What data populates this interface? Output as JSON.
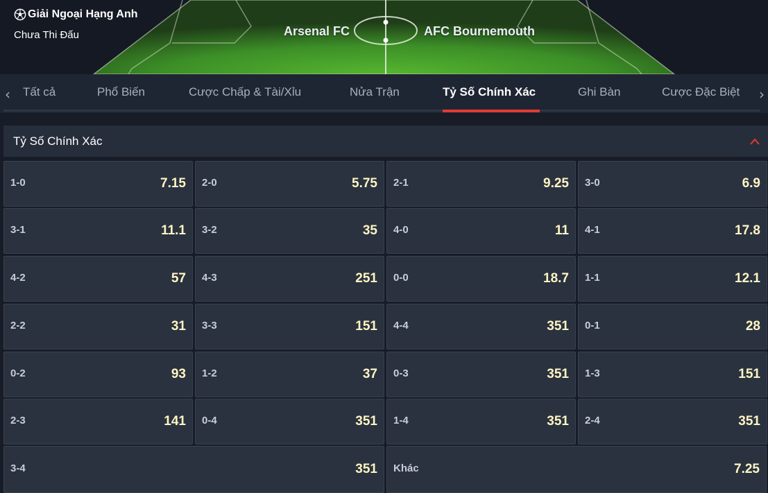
{
  "header": {
    "league": "Giải Ngoại Hạng Anh",
    "status": "Chưa Thi Đấu",
    "home_team": "Arsenal FC",
    "away_team": "AFC Bournemouth",
    "league_icon": "soccer-ball-icon"
  },
  "tabs": [
    {
      "label": "Tất cả",
      "active": false
    },
    {
      "label": "Phổ Biến",
      "active": false
    },
    {
      "label": "Cược Chấp & Tài/Xỉu",
      "active": false
    },
    {
      "label": "Nửa Trận",
      "active": false
    },
    {
      "label": "Tỷ Số Chính Xác",
      "active": true
    },
    {
      "label": "Ghi Bàn",
      "active": false
    },
    {
      "label": "Cược Đặc Biệt",
      "active": false
    }
  ],
  "tab_nav": {
    "prev_icon": "chevron-left-icon",
    "next_icon": "chevron-right-icon"
  },
  "section": {
    "title": "Tỷ Số Chính Xác",
    "collapse_icon": "chevron-up-icon"
  },
  "odds": [
    {
      "score": "1-0",
      "price": "7.15"
    },
    {
      "score": "2-0",
      "price": "5.75"
    },
    {
      "score": "2-1",
      "price": "9.25"
    },
    {
      "score": "3-0",
      "price": "6.9"
    },
    {
      "score": "3-1",
      "price": "11.1"
    },
    {
      "score": "3-2",
      "price": "35"
    },
    {
      "score": "4-0",
      "price": "11"
    },
    {
      "score": "4-1",
      "price": "17.8"
    },
    {
      "score": "4-2",
      "price": "57"
    },
    {
      "score": "4-3",
      "price": "251"
    },
    {
      "score": "0-0",
      "price": "18.7"
    },
    {
      "score": "1-1",
      "price": "12.1"
    },
    {
      "score": "2-2",
      "price": "31"
    },
    {
      "score": "3-3",
      "price": "151"
    },
    {
      "score": "4-4",
      "price": "351"
    },
    {
      "score": "0-1",
      "price": "28"
    },
    {
      "score": "0-2",
      "price": "93"
    },
    {
      "score": "1-2",
      "price": "37"
    },
    {
      "score": "0-3",
      "price": "351"
    },
    {
      "score": "1-3",
      "price": "151"
    },
    {
      "score": "2-3",
      "price": "141"
    },
    {
      "score": "0-4",
      "price": "351"
    },
    {
      "score": "1-4",
      "price": "351"
    },
    {
      "score": "2-4",
      "price": "351"
    },
    {
      "score": "3-4",
      "price": "351"
    },
    {
      "score": "Khác",
      "price": "7.25"
    }
  ],
  "colors": {
    "accent": "#e23a32",
    "price": "#fff5c2",
    "pitch": "#3f9c2c"
  }
}
